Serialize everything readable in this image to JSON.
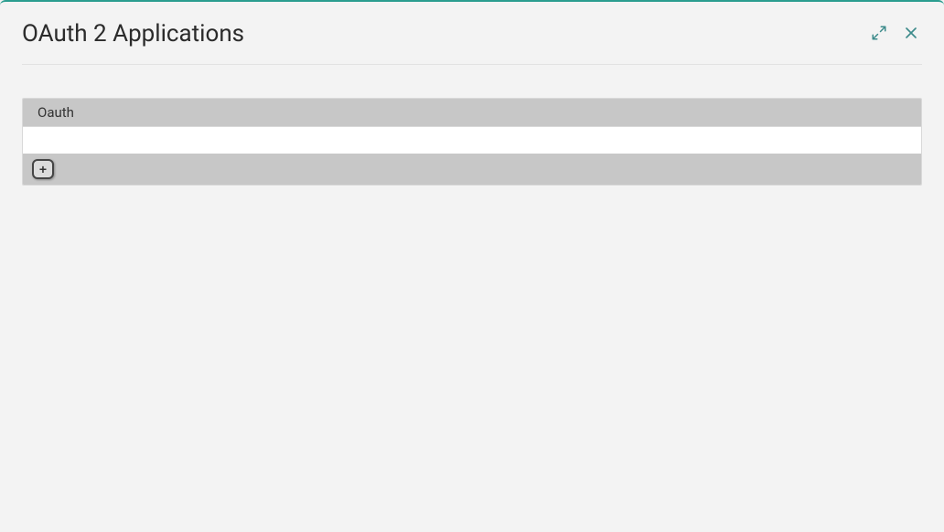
{
  "header": {
    "title": "OAuth 2 Applications"
  },
  "table": {
    "columnHeader": "Oauth",
    "addLabel": "+"
  }
}
